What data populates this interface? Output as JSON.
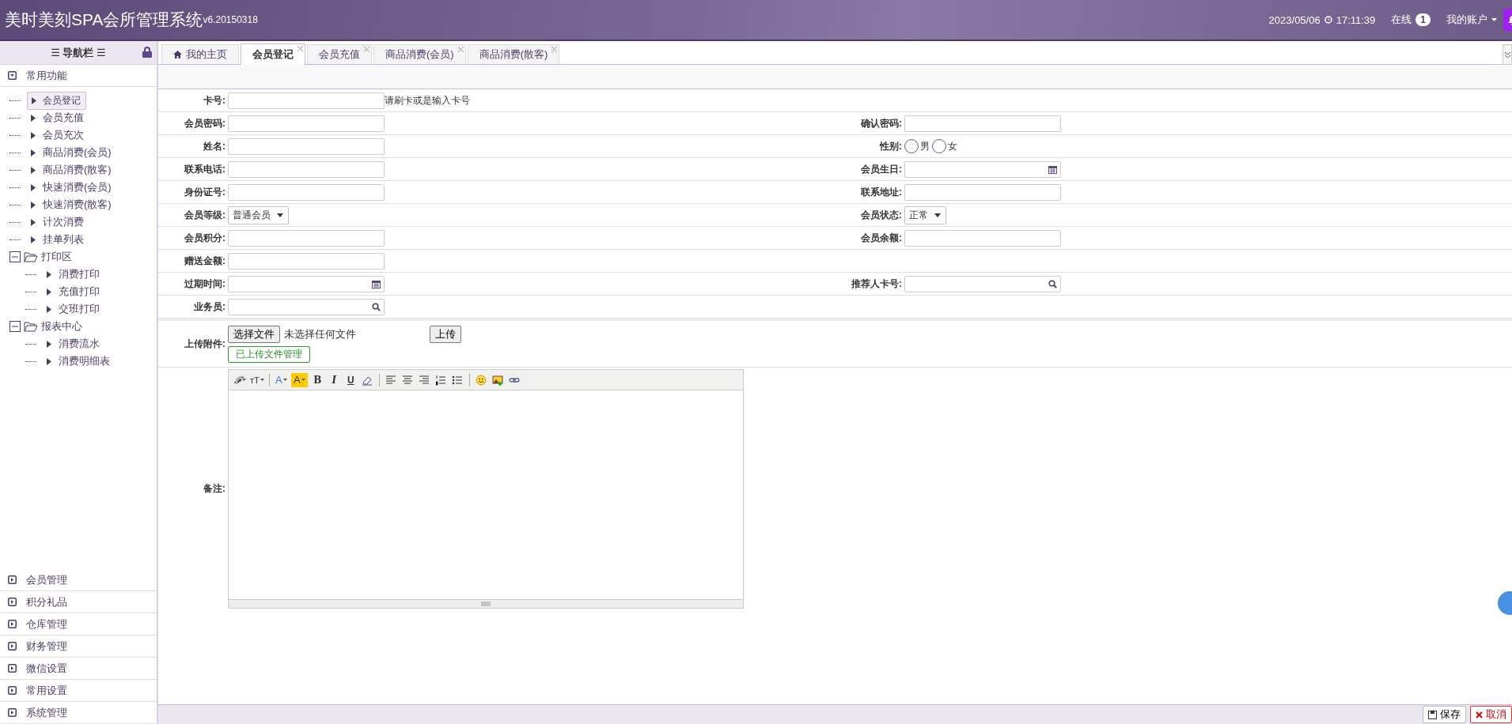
{
  "header": {
    "title": "美时美刻SPA会所管理系统",
    "version": "v6.20150318",
    "date": "2023/05/06",
    "time": "17:11:39",
    "online_label": "在线",
    "online_count": "1",
    "account": "我的账户"
  },
  "sidebar": {
    "title": "☰ 导航栏 ☰",
    "sections": [
      {
        "label": "常用功能",
        "expanded": true,
        "items": [
          {
            "kind": "leaf",
            "label": "会员登记",
            "selected": true
          },
          {
            "kind": "leaf",
            "label": "会员充值",
            "selected": false
          },
          {
            "kind": "leaf",
            "label": "会员充次",
            "selected": false
          },
          {
            "kind": "leaf",
            "label": "商品消费(会员)",
            "selected": false
          },
          {
            "kind": "leaf",
            "label": "商品消费(散客)",
            "selected": false
          },
          {
            "kind": "leaf",
            "label": "快速消费(会员)",
            "selected": false
          },
          {
            "kind": "leaf",
            "label": "快速消费(散客)",
            "selected": false
          },
          {
            "kind": "leaf",
            "label": "计次消费",
            "selected": false
          },
          {
            "kind": "leaf",
            "label": "挂单列表",
            "selected": false
          },
          {
            "kind": "folder",
            "label": "打印区",
            "expanded": true,
            "children": [
              {
                "kind": "leaf",
                "label": "消费打印",
                "selected": false
              },
              {
                "kind": "leaf",
                "label": "充值打印",
                "selected": false
              },
              {
                "kind": "leaf",
                "label": "交班打印",
                "selected": false
              }
            ]
          },
          {
            "kind": "folder",
            "label": "报表中心",
            "expanded": true,
            "children": [
              {
                "kind": "leaf",
                "label": "消费流水",
                "selected": false
              },
              {
                "kind": "leaf",
                "label": "消费明细表",
                "selected": false
              }
            ]
          }
        ]
      },
      {
        "label": "会员管理",
        "expanded": false
      },
      {
        "label": "积分礼品",
        "expanded": false
      },
      {
        "label": "仓库管理",
        "expanded": false
      },
      {
        "label": "财务管理",
        "expanded": false
      },
      {
        "label": "微信设置",
        "expanded": false
      },
      {
        "label": "常用设置",
        "expanded": false
      },
      {
        "label": "系统管理",
        "expanded": false
      }
    ]
  },
  "tabs": [
    {
      "label": "我的主页",
      "kind": "home",
      "selected": false,
      "closable": false
    },
    {
      "label": "会员登记",
      "kind": "page",
      "selected": true,
      "closable": true
    },
    {
      "label": "会员充值",
      "kind": "page",
      "selected": false,
      "closable": true
    },
    {
      "label": "商品消费(会员)",
      "kind": "page",
      "selected": false,
      "closable": true
    },
    {
      "label": "商品消费(散客)",
      "kind": "page",
      "selected": false,
      "closable": true
    }
  ],
  "form": {
    "rows": [
      [
        {
          "label": "卡号:",
          "kind": "text",
          "hint": "请刷卡或是输入卡号"
        }
      ],
      [
        {
          "label": "会员密码:",
          "kind": "text"
        },
        {
          "label": "确认密码:",
          "kind": "text"
        }
      ],
      [
        {
          "label": "姓名:",
          "kind": "text"
        },
        {
          "label": "性别:",
          "kind": "radio",
          "options": [
            {
              "label": "男",
              "selected": false
            },
            {
              "label": "女",
              "selected": false
            }
          ]
        }
      ],
      [
        {
          "label": "联系电话:",
          "kind": "text"
        },
        {
          "label": "会员生日:",
          "kind": "date"
        }
      ],
      [
        {
          "label": "身份证号:",
          "kind": "text"
        },
        {
          "label": "联系地址:",
          "kind": "text"
        }
      ],
      [
        {
          "label": "会员等级:",
          "kind": "select",
          "value": "普通会员"
        },
        {
          "label": "会员状态:",
          "kind": "select",
          "value": "正常"
        }
      ],
      [
        {
          "label": "会员积分:",
          "kind": "text"
        },
        {
          "label": "会员余额:",
          "kind": "text"
        }
      ],
      [
        {
          "label": "赠送金额:",
          "kind": "text"
        }
      ],
      [
        {
          "label": "过期时间:",
          "kind": "date"
        },
        {
          "label": "推荐人卡号:",
          "kind": "search"
        }
      ],
      [
        {
          "label": "业务员:",
          "kind": "search"
        }
      ]
    ],
    "upload": {
      "label": "上传附件:",
      "choose_button": "选择文件",
      "status": "未选择任何文件",
      "upload_button": "上传",
      "manage_button": "已上传文件管理"
    },
    "remark": {
      "label": "备注:",
      "toolbar": [
        {
          "kind": "font",
          "glyph": "𝓕"
        },
        {
          "kind": "size",
          "glyph": "ᴛT"
        },
        {
          "kind": "sep"
        },
        {
          "kind": "color",
          "glyph": "A"
        },
        {
          "kind": "highlight",
          "glyph": "A"
        },
        {
          "kind": "bold",
          "glyph": "B"
        },
        {
          "kind": "italic",
          "glyph": "I"
        },
        {
          "kind": "underline",
          "glyph": "U"
        },
        {
          "kind": "eraser"
        },
        {
          "kind": "sep"
        },
        {
          "kind": "align-left"
        },
        {
          "kind": "align-center"
        },
        {
          "kind": "align-right"
        },
        {
          "kind": "ordered-list"
        },
        {
          "kind": "bullet-list"
        },
        {
          "kind": "sep"
        },
        {
          "kind": "emoji"
        },
        {
          "kind": "image"
        },
        {
          "kind": "link"
        }
      ]
    }
  },
  "footer": {
    "buttons": [
      {
        "kind": "save",
        "label": "保存"
      },
      {
        "kind": "cancel",
        "label": "取消"
      }
    ]
  }
}
